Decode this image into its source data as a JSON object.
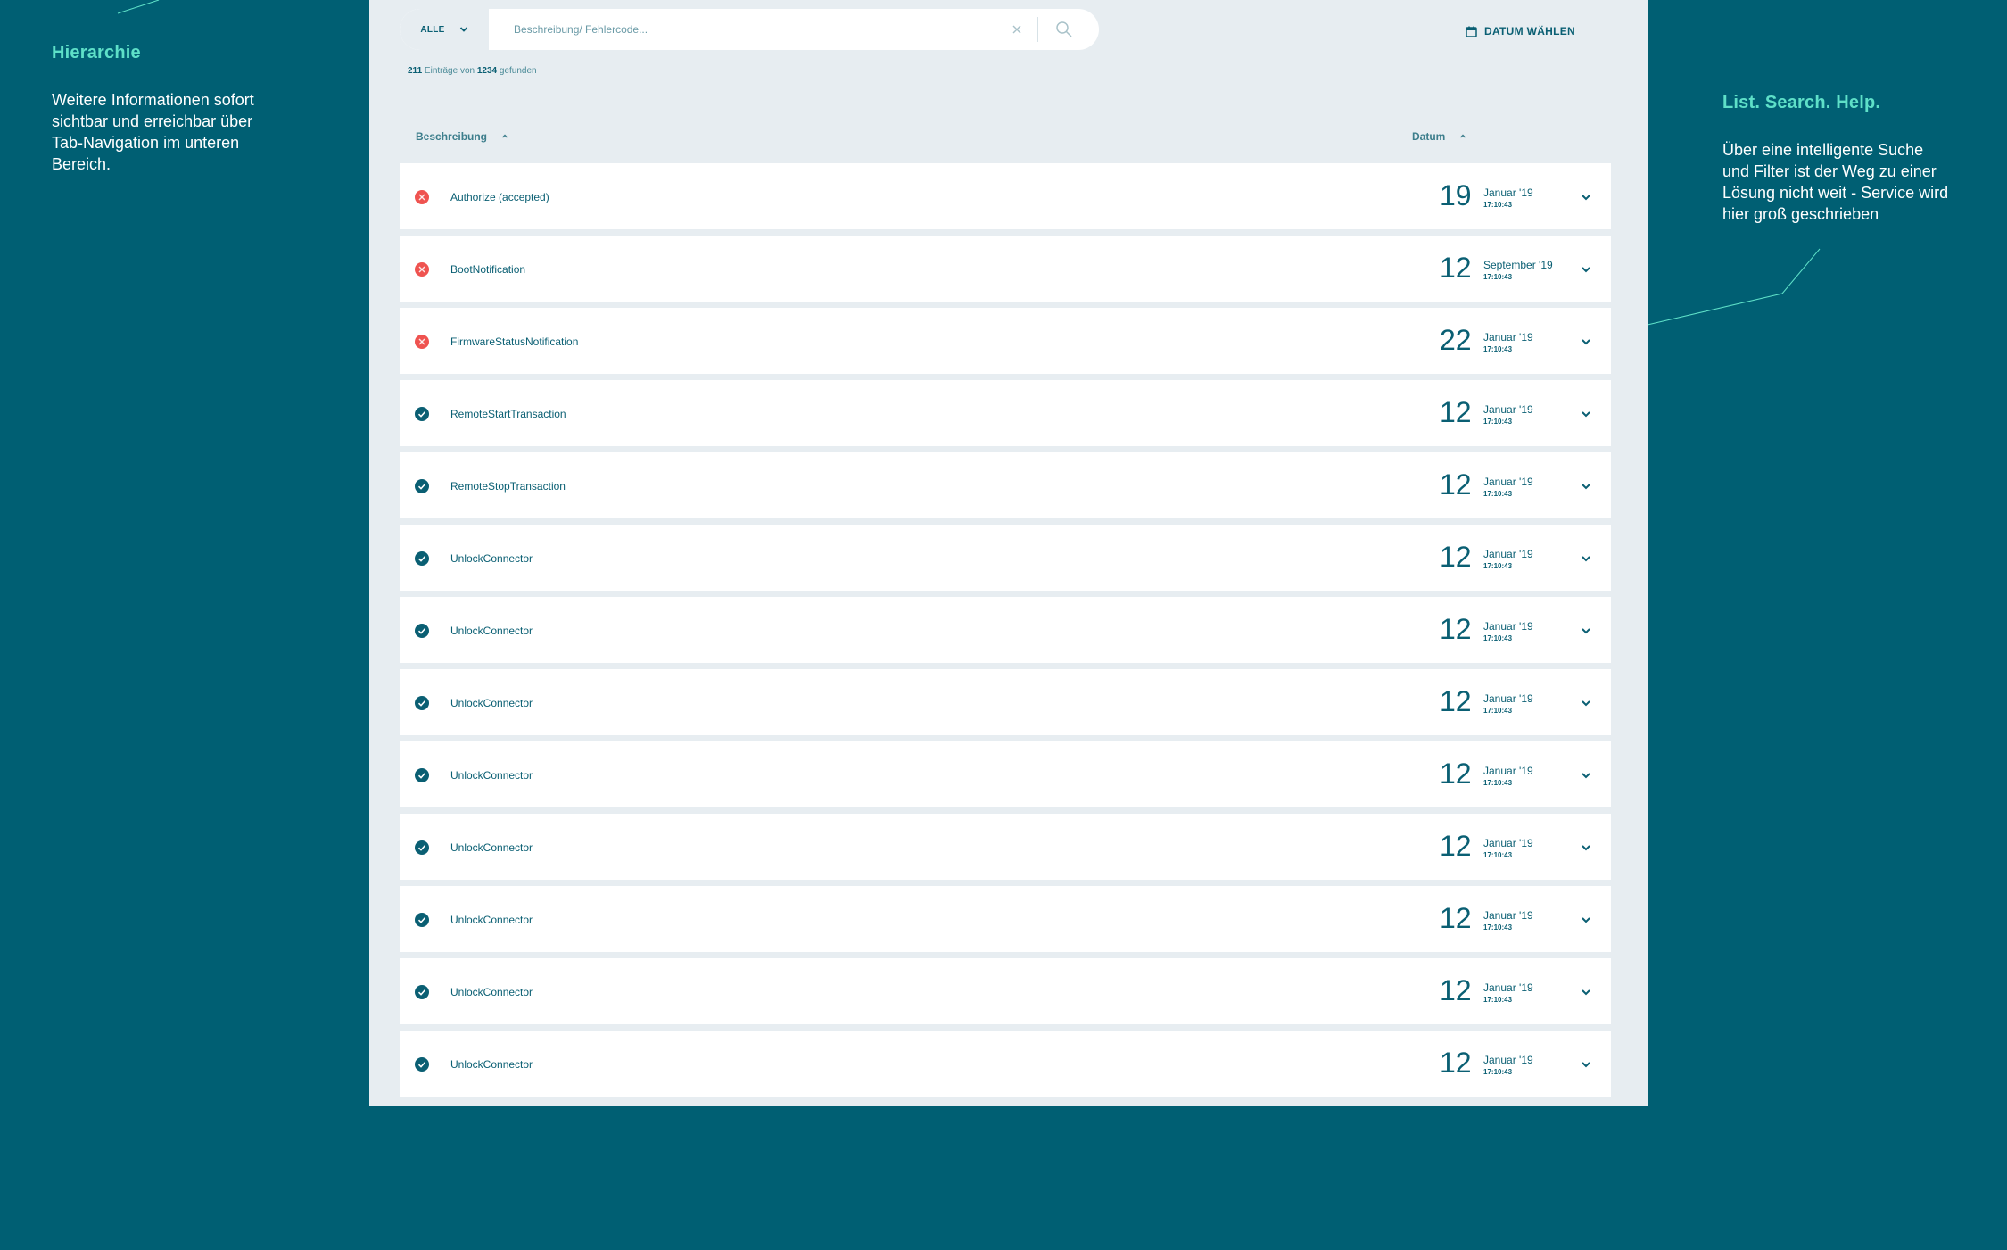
{
  "annotations": {
    "left": {
      "title": "Hierarchie",
      "text": "Weitere Informationen sofort sichtbar und erreichbar über Tab-Navigation im unteren Bereich."
    },
    "right": {
      "title": "List. Search. Help.",
      "text": "Über eine intelligente Suche und Filter ist der Weg zu einer Lösung nicht weit - Service wird hier groß geschrieben"
    }
  },
  "search": {
    "filter_label": "ALLE",
    "placeholder": "Beschreibung/ Fehlercode...",
    "value": ""
  },
  "date_button_label": "DATUM WÄHLEN",
  "result_count": {
    "shown": "211",
    "mid": "Einträge von",
    "total": "1234",
    "suffix": "gefunden"
  },
  "columns": {
    "description": "Beschreibung",
    "date": "Datum"
  },
  "rows": [
    {
      "status": "error",
      "label": "Authorize (accepted)",
      "day": "19",
      "month": "Januar '19",
      "time": "17:10:43"
    },
    {
      "status": "error",
      "label": "BootNotification",
      "day": "12",
      "month": "September '19",
      "time": "17:10:43"
    },
    {
      "status": "error",
      "label": "FirmwareStatusNotification",
      "day": "22",
      "month": "Januar '19",
      "time": "17:10:43"
    },
    {
      "status": "success",
      "label": "RemoteStartTransaction",
      "day": "12",
      "month": "Januar '19",
      "time": "17:10:43"
    },
    {
      "status": "success",
      "label": "RemoteStopTransaction",
      "day": "12",
      "month": "Januar '19",
      "time": "17:10:43"
    },
    {
      "status": "success",
      "label": "UnlockConnector",
      "day": "12",
      "month": "Januar '19",
      "time": "17:10:43"
    },
    {
      "status": "success",
      "label": "UnlockConnector",
      "day": "12",
      "month": "Januar '19",
      "time": "17:10:43"
    },
    {
      "status": "success",
      "label": "UnlockConnector",
      "day": "12",
      "month": "Januar '19",
      "time": "17:10:43"
    },
    {
      "status": "success",
      "label": "UnlockConnector",
      "day": "12",
      "month": "Januar '19",
      "time": "17:10:43"
    },
    {
      "status": "success",
      "label": "UnlockConnector",
      "day": "12",
      "month": "Januar '19",
      "time": "17:10:43"
    },
    {
      "status": "success",
      "label": "UnlockConnector",
      "day": "12",
      "month": "Januar '19",
      "time": "17:10:43"
    },
    {
      "status": "success",
      "label": "UnlockConnector",
      "day": "12",
      "month": "Januar '19",
      "time": "17:10:43"
    },
    {
      "status": "success",
      "label": "UnlockConnector",
      "day": "12",
      "month": "Januar '19",
      "time": "17:10:43"
    }
  ],
  "colors": {
    "background": "#005f73",
    "panel": "#e7edf1",
    "accent": "#5ee0c8",
    "error": "#ef5350",
    "success": "#0a5f73"
  },
  "icons": {
    "error_status": "error-x-circle-icon",
    "success_status": "check-circle-icon",
    "expand": "chevron-down-icon",
    "calendar": "calendar-icon",
    "search": "search-icon",
    "clear": "close-icon"
  }
}
